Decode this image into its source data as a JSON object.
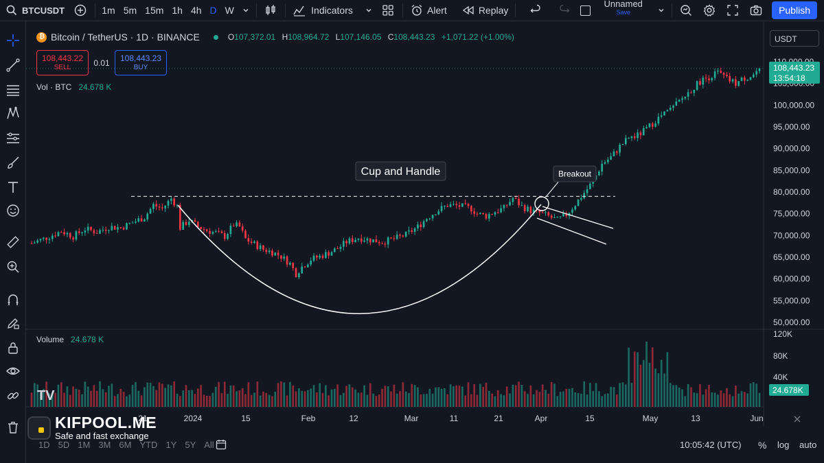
{
  "toolbar": {
    "symbol": "BTCUSDT",
    "timeframes": [
      "1m",
      "5m",
      "15m",
      "1h",
      "4h",
      "D",
      "W"
    ],
    "active_timeframe": "D",
    "indicators_label": "Indicators",
    "alert_label": "Alert",
    "replay_label": "Replay",
    "layout_name": "Unnamed",
    "layout_status": "Save",
    "publish_label": "Publish"
  },
  "legend": {
    "title": "Bitcoin / TetherUS · 1D · BINANCE",
    "open_key": "O",
    "open": "107,372.01",
    "high_key": "H",
    "high": "108,964.72",
    "low_key": "L",
    "low": "107,146.05",
    "close_key": "C",
    "close": "108,443.23",
    "change": "+1,071.22 (+1.00%)"
  },
  "trade": {
    "sell_price": "108,443.22",
    "sell_label": "SELL",
    "qty": "0.01",
    "buy_price": "108,443.23",
    "buy_label": "BUY"
  },
  "volume_legend": {
    "label": "Vol · BTC",
    "value": "24.678 K"
  },
  "volume_pane_legend": {
    "label": "Volume",
    "value": "24.678 K"
  },
  "currency_selector": "USDT",
  "chart_data": {
    "type": "candlestick",
    "title": "Bitcoin / TetherUS · 1D · BINANCE",
    "y_ticks": [
      "110,000.00",
      "105,000.00",
      "100,000.00",
      "95,000.00",
      "90,000.00",
      "85,000.00",
      "80,000.00",
      "75,000.00",
      "70,000.00",
      "65,000.00",
      "60,000.00",
      "55,000.00",
      "50,000.00"
    ],
    "ylim": [
      50000,
      110000
    ],
    "x_ticks": [
      "21",
      "2024",
      "15",
      "Feb",
      "12",
      "Mar",
      "11",
      "21",
      "Apr",
      "15",
      "May",
      "13",
      "Jun"
    ],
    "last_price": "108,443.23",
    "countdown": "13:54:18",
    "resistance_level": 79000,
    "annotations": [
      "Cup and Handle",
      "Breakout"
    ],
    "price_points": [
      [
        0,
        68200
      ],
      [
        5,
        69500
      ],
      [
        10,
        71000
      ],
      [
        14,
        69800
      ],
      [
        18,
        71500
      ],
      [
        22,
        70800
      ],
      [
        26,
        72000
      ],
      [
        30,
        71800
      ],
      [
        34,
        73000
      ],
      [
        38,
        74200
      ],
      [
        41,
        77000
      ],
      [
        44,
        76200
      ],
      [
        47,
        78500
      ],
      [
        49,
        76800
      ],
      [
        50,
        71800
      ],
      [
        53,
        73500
      ],
      [
        56,
        72000
      ],
      [
        59,
        71200
      ],
      [
        62,
        70600
      ],
      [
        65,
        69800
      ],
      [
        68,
        72500
      ],
      [
        70,
        72000
      ],
      [
        72,
        69200
      ],
      [
        75,
        68000
      ],
      [
        78,
        66800
      ],
      [
        81,
        66200
      ],
      [
        84,
        65200
      ],
      [
        87,
        63500
      ],
      [
        89,
        61200
      ],
      [
        91,
        62800
      ],
      [
        94,
        64500
      ],
      [
        97,
        65200
      ],
      [
        100,
        66000
      ],
      [
        103,
        67000
      ],
      [
        106,
        68500
      ],
      [
        110,
        69500
      ],
      [
        114,
        69000
      ],
      [
        118,
        68500
      ],
      [
        122,
        69200
      ],
      [
        126,
        70200
      ],
      [
        130,
        72000
      ],
      [
        133,
        74000
      ],
      [
        136,
        75500
      ],
      [
        140,
        77000
      ],
      [
        144,
        76800
      ],
      [
        148,
        76200
      ],
      [
        150,
        75000
      ],
      [
        153,
        74500
      ],
      [
        156,
        75500
      ],
      [
        159,
        76300
      ],
      [
        162,
        78600
      ],
      [
        165,
        76700
      ],
      [
        168,
        75700
      ],
      [
        171,
        75200
      ],
      [
        174,
        74400
      ],
      [
        177,
        73500
      ],
      [
        180,
        74800
      ],
      [
        183,
        77200
      ],
      [
        186,
        79800
      ],
      [
        189,
        82500
      ],
      [
        192,
        86500
      ],
      [
        195,
        88000
      ],
      [
        198,
        90500
      ],
      [
        201,
        92500
      ],
      [
        204,
        93000
      ],
      [
        207,
        94500
      ],
      [
        210,
        96500
      ],
      [
        213,
        98000
      ],
      [
        216,
        99500
      ],
      [
        219,
        101500
      ],
      [
        222,
        103500
      ],
      [
        225,
        105500
      ],
      [
        228,
        106500
      ],
      [
        231,
        107500
      ],
      [
        234,
        106000
      ],
      [
        237,
        105000
      ],
      [
        240,
        106200
      ],
      [
        243,
        107000
      ],
      [
        245,
        108443
      ]
    ],
    "n_bars": 246,
    "volume_ticks": [
      "120K",
      "80K",
      "40K"
    ],
    "volume_last": "24.678K"
  },
  "bottom": {
    "ranges": [
      "1D",
      "5D",
      "1M",
      "3M",
      "6M",
      "YTD",
      "1Y",
      "5Y",
      "All"
    ],
    "clock": "10:05:42 (UTC)",
    "percent": "%",
    "log": "log",
    "auto": "auto"
  },
  "watermark": {
    "brand": "KIFPOOL.ME",
    "tagline": "Safe and fast exchange"
  },
  "colors": {
    "up": "#22ab94",
    "down": "#f23645",
    "accent": "#2962ff",
    "bg": "#131722"
  }
}
